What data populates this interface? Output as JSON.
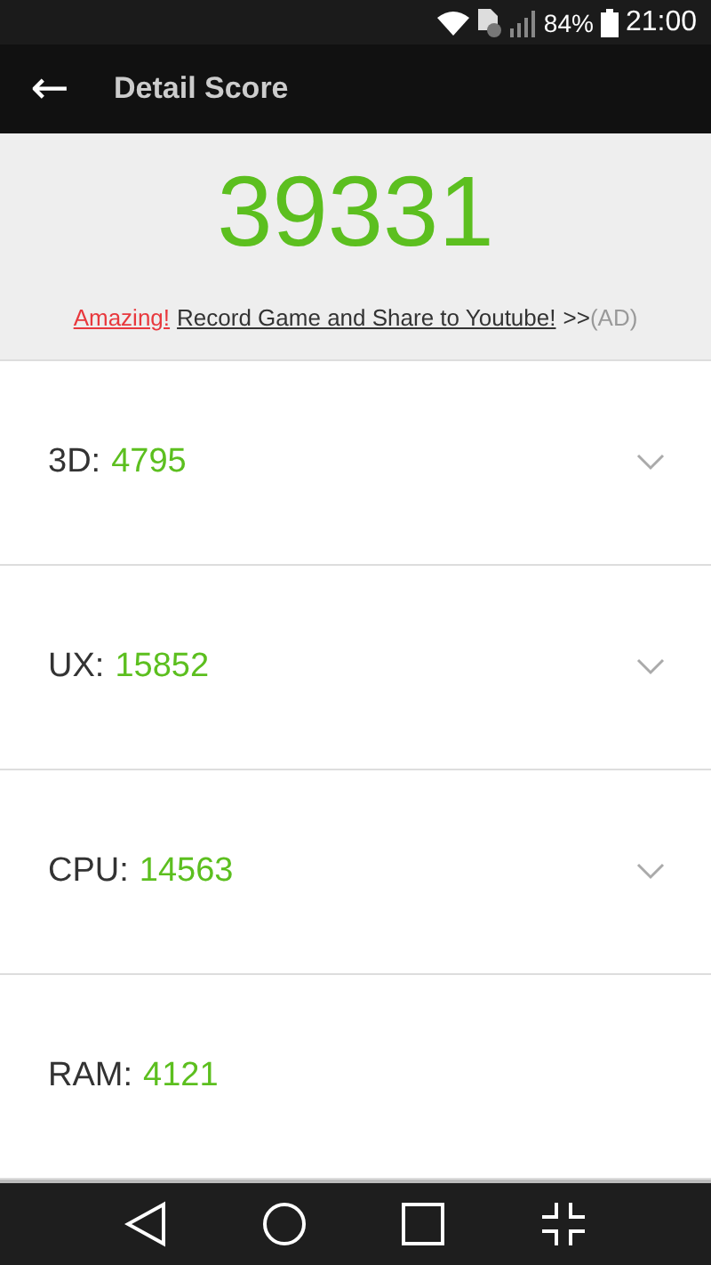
{
  "status_bar": {
    "battery": "84%",
    "time": "21:00"
  },
  "app_bar": {
    "back": "←",
    "title": "Detail Score"
  },
  "total_score": "39331",
  "ad": {
    "highlight": "Amazing!",
    "link": "Record Game and Share to Youtube!",
    "arrows": ">>",
    "tag": "(AD)"
  },
  "scores": [
    {
      "label": "3D:",
      "value": "4795",
      "kind": "expandable",
      "expanded": false
    },
    {
      "label": "UX:",
      "value": "15852",
      "kind": "expandable",
      "expanded": false
    },
    {
      "label": "CPU:",
      "value": "14563",
      "kind": "expandable",
      "expanded": false
    },
    {
      "label": "RAM:",
      "value": "4121",
      "kind": "plain"
    }
  ]
}
